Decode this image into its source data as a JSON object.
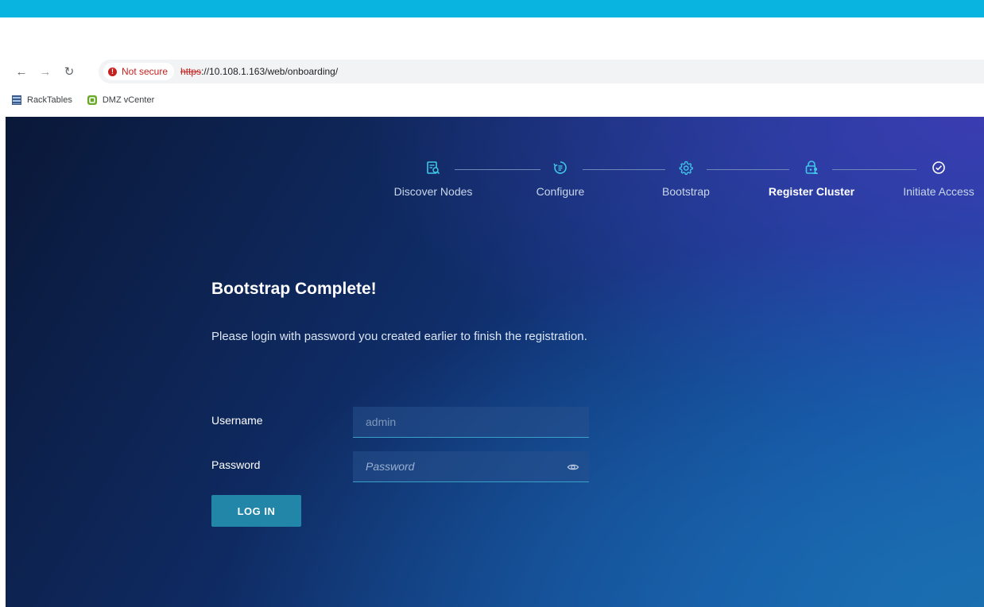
{
  "browser": {
    "security_label": "Not secure",
    "url_scheme": "https",
    "url_rest": "://10.108.1.163/web/onboarding/",
    "bookmarks": [
      {
        "label": "RackTables",
        "icon": "server-icon"
      },
      {
        "label": "DMZ vCenter",
        "icon": "vcenter-icon"
      }
    ]
  },
  "stepper": {
    "steps": [
      {
        "label": "Discover Nodes",
        "icon": "discover-icon",
        "state": "done"
      },
      {
        "label": "Configure",
        "icon": "configure-icon",
        "state": "done"
      },
      {
        "label": "Bootstrap",
        "icon": "gear-icon",
        "state": "done"
      },
      {
        "label": "Register Cluster",
        "icon": "lock-user-icon",
        "state": "active"
      },
      {
        "label": "Initiate Access",
        "icon": "check-circle-icon",
        "state": "pending"
      }
    ]
  },
  "main": {
    "title": "Bootstrap Complete!",
    "subtitle": "Please login with password you created earlier to finish the registration.",
    "username_label": "Username",
    "username_value": "admin",
    "password_label": "Password",
    "password_placeholder": "Password",
    "login_button": "LOG IN"
  },
  "colors": {
    "accent": "#0ab4e0",
    "button": "#2286a8",
    "warning": "#c5221f"
  }
}
